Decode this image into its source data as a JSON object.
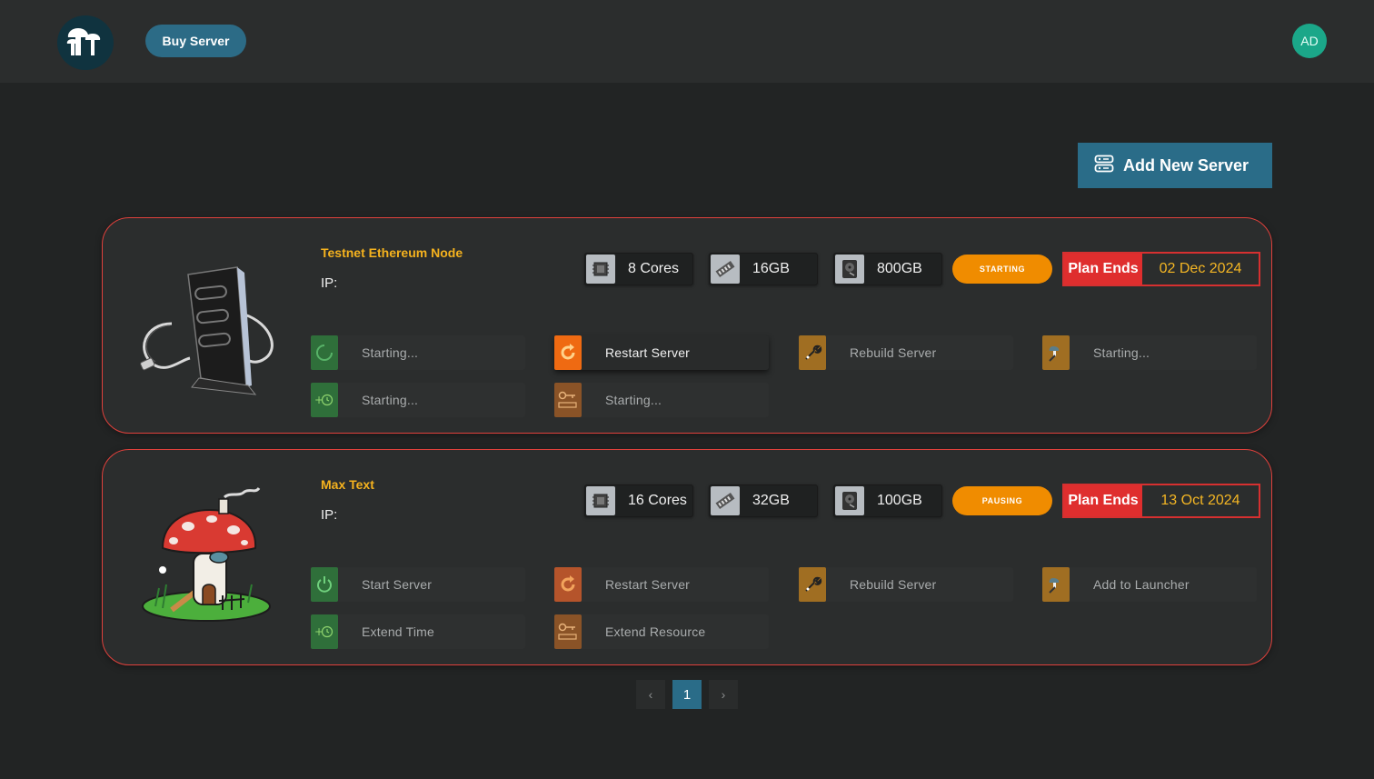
{
  "header": {
    "buy_server_label": "Buy Server",
    "avatar_initials": "AD"
  },
  "toolbar": {
    "add_new_server_label": "Add New Server"
  },
  "servers": [
    {
      "name": "Testnet Ethereum Node",
      "ip_label": "IP:",
      "image": "server-tower-icon",
      "cpu": "8 Cores",
      "ram": "16GB",
      "disk": "800GB",
      "status": "STARTING",
      "plan_label": "Plan Ends",
      "plan_date": "02 Dec 2024",
      "actions": {
        "start": "Starting...",
        "restart": "Restart Server",
        "rebuild": "Rebuild Server",
        "launcher": "Starting...",
        "extend_time": "Starting...",
        "extend_resource": "Starting..."
      }
    },
    {
      "name": "Max Text",
      "ip_label": "IP:",
      "image": "mushroom-house-icon",
      "cpu": "16 Cores",
      "ram": "32GB",
      "disk": "100GB",
      "status": "PAUSING",
      "plan_label": "Plan Ends",
      "plan_date": "13 Oct 2024",
      "actions": {
        "start": "Start Server",
        "restart": "Restart Server",
        "rebuild": "Rebuild Server",
        "launcher": "Add to Launcher",
        "extend_time": "Extend Time",
        "extend_resource": "Extend Resource"
      }
    }
  ],
  "pagination": {
    "prev": "‹",
    "current": "1",
    "next": "›"
  },
  "colors": {
    "background": "#222424",
    "topbar": "#2b2d2d",
    "accent": "#2a6c88",
    "card_border": "#e0413c",
    "title": "#f5b21e",
    "status": "#f08c00",
    "plan_label_bg": "#df2e2e",
    "plan_date": "#f4b624",
    "avatar": "#1ba789"
  }
}
